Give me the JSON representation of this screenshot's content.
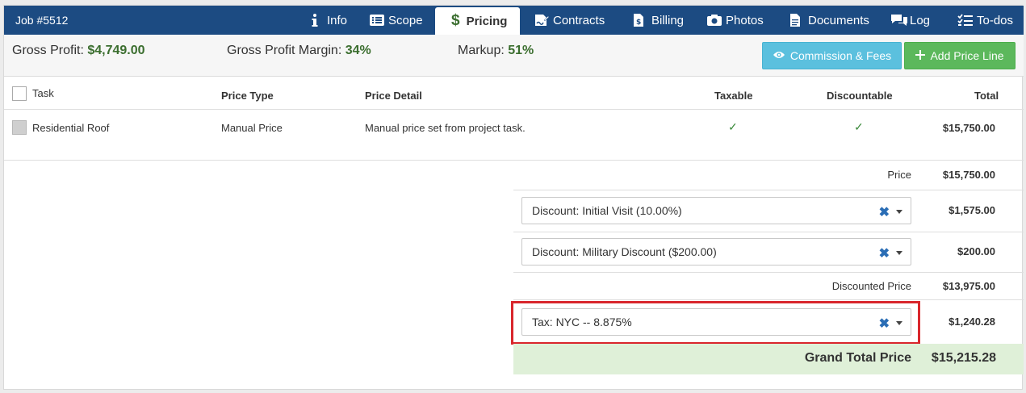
{
  "header": {
    "job_title": "Job #5512",
    "tabs": [
      {
        "label": "Info",
        "icon": "info-icon"
      },
      {
        "label": "Scope",
        "icon": "list-icon"
      },
      {
        "label": "Pricing",
        "icon": "dollar-icon",
        "active": true
      },
      {
        "label": "Contracts",
        "icon": "signature-icon"
      },
      {
        "label": "Billing",
        "icon": "invoice-icon"
      },
      {
        "label": "Photos",
        "icon": "camera-icon"
      },
      {
        "label": "Documents",
        "icon": "document-icon"
      },
      {
        "label": "Log",
        "icon": "comments-icon"
      },
      {
        "label": "To-dos",
        "icon": "checklist-icon"
      }
    ]
  },
  "stats": {
    "gross_profit_label": "Gross Profit:",
    "gross_profit_value": "$4,749.00",
    "gross_margin_label": "Gross Profit Margin:",
    "gross_margin_value": "34%",
    "markup_label": "Markup:",
    "markup_value": "51%"
  },
  "buttons": {
    "commission": "Commission & Fees",
    "add_price_line": "Add Price Line"
  },
  "table": {
    "headers": {
      "task": "Task",
      "price_type": "Price Type",
      "price_detail": "Price Detail",
      "taxable": "Taxable",
      "discountable": "Discountable",
      "total": "Total"
    },
    "rows": [
      {
        "task": "Residential Roof",
        "price_type": "Manual Price",
        "price_detail": "Manual price set from project task.",
        "taxable": "✓",
        "discountable": "✓",
        "total": "$15,750.00"
      }
    ]
  },
  "summary": {
    "price_label": "Price",
    "price_value": "$15,750.00",
    "discount1": "Discount: Initial Visit (10.00%)",
    "discount1_value": "$1,575.00",
    "discount2": "Discount: Military Discount ($200.00)",
    "discount2_value": "$200.00",
    "discounted_label": "Discounted Price",
    "discounted_value": "$13,975.00",
    "tax": "Tax: NYC -- 8.875%",
    "tax_value": "$1,240.28",
    "grand_label": "Grand Total Price",
    "grand_value": "$15,215.28"
  },
  "colors": {
    "nav": "#1c4b82",
    "positive": "#3b6e2f",
    "info_button": "#5bc0de",
    "success_button": "#5cb85c",
    "highlight": "#d9262c",
    "grand_bg": "#dff0d8"
  }
}
